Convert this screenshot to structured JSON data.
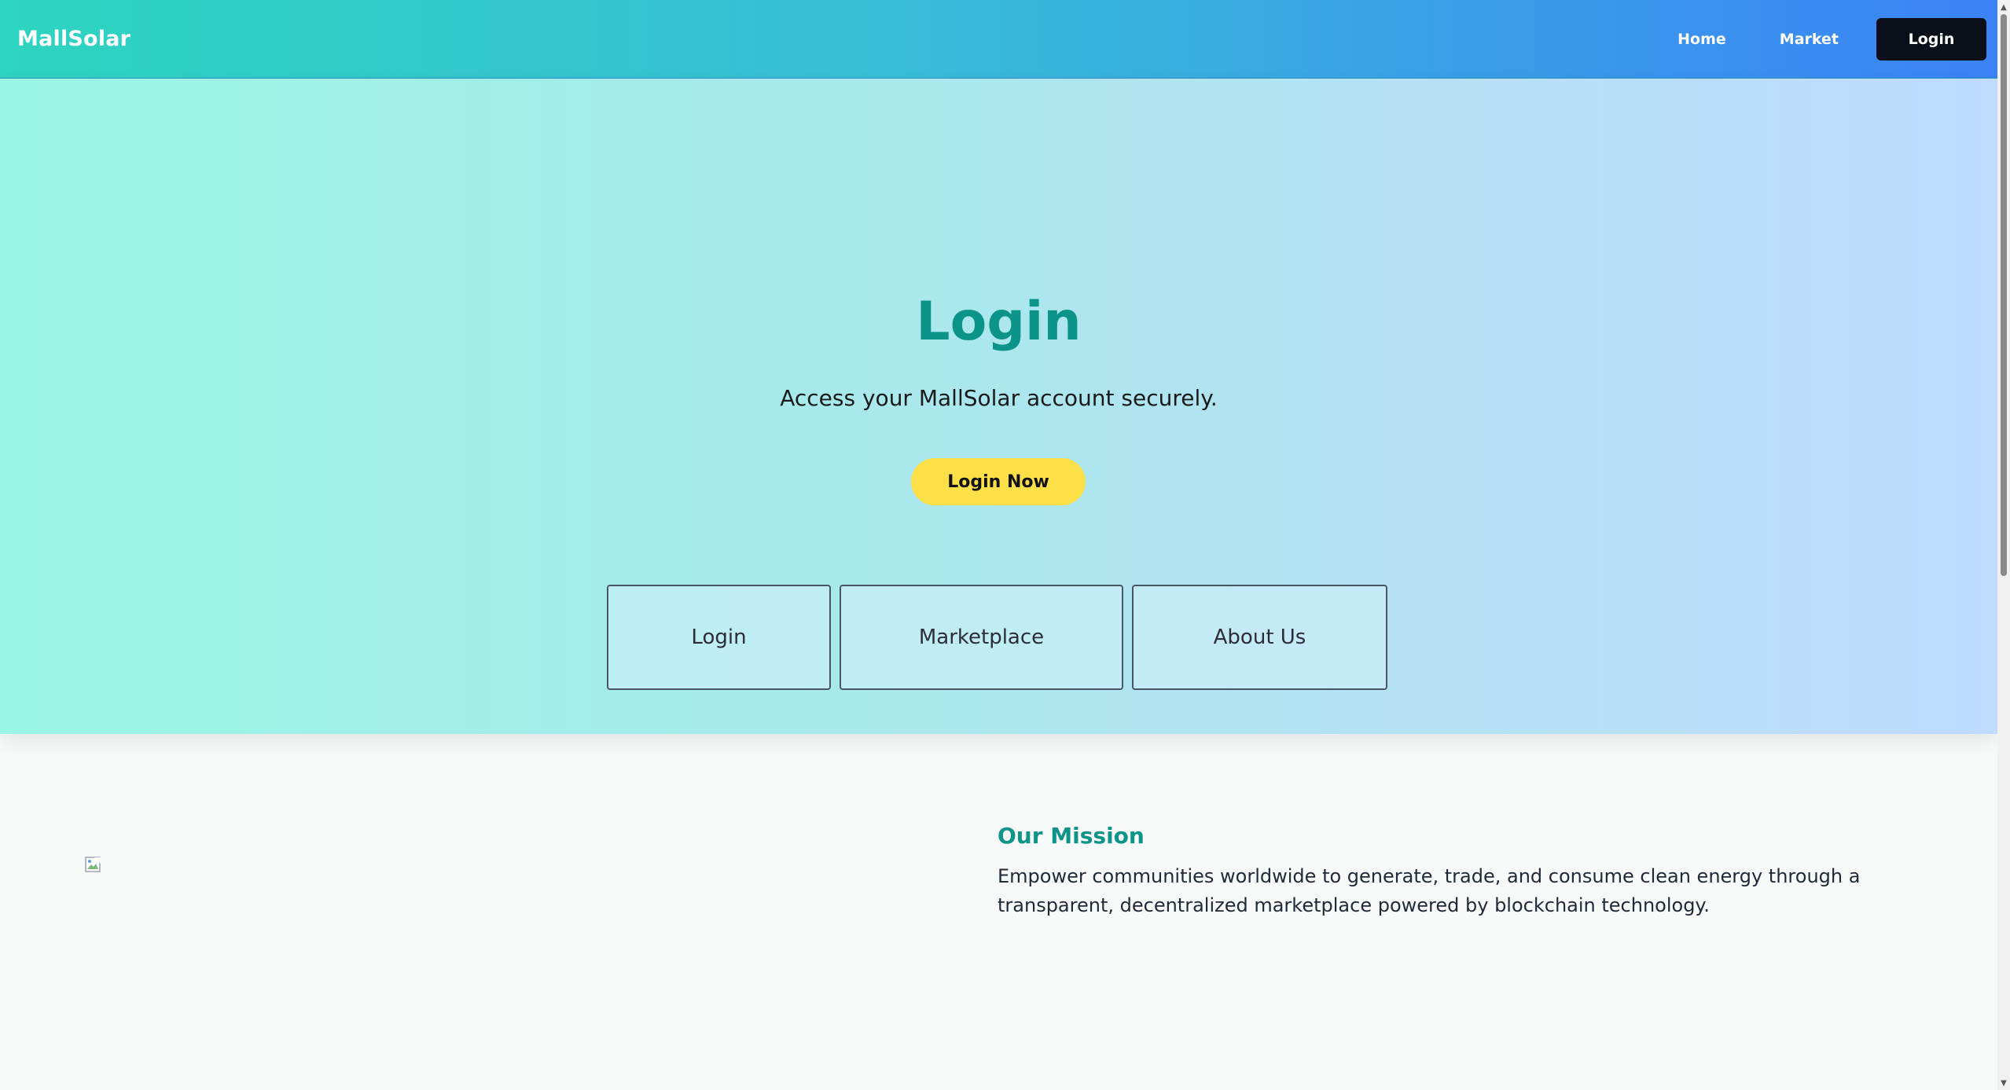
{
  "navbar": {
    "brand": "MallSolar",
    "links": [
      "Home",
      "Market"
    ],
    "login_label": "Login"
  },
  "hero": {
    "title": "Login",
    "subtitle": "Access your MallSolar account securely.",
    "cta_label": "Login Now",
    "cards": [
      "Login",
      "Marketplace",
      "About Us"
    ]
  },
  "mission": {
    "heading": "Our Mission",
    "text": "Empower communities worldwide to generate, trade, and consume clean energy through a transparent, decentralized marketplace powered by blockchain technology.",
    "image_icon": "broken-image-icon"
  },
  "colors": {
    "nav_gradient_start": "#2dd4bf",
    "nav_gradient_end": "#3b82f6",
    "accent_teal": "#0d9488",
    "cta_yellow": "#fde047",
    "nav_login_bg": "#0b0f19"
  }
}
